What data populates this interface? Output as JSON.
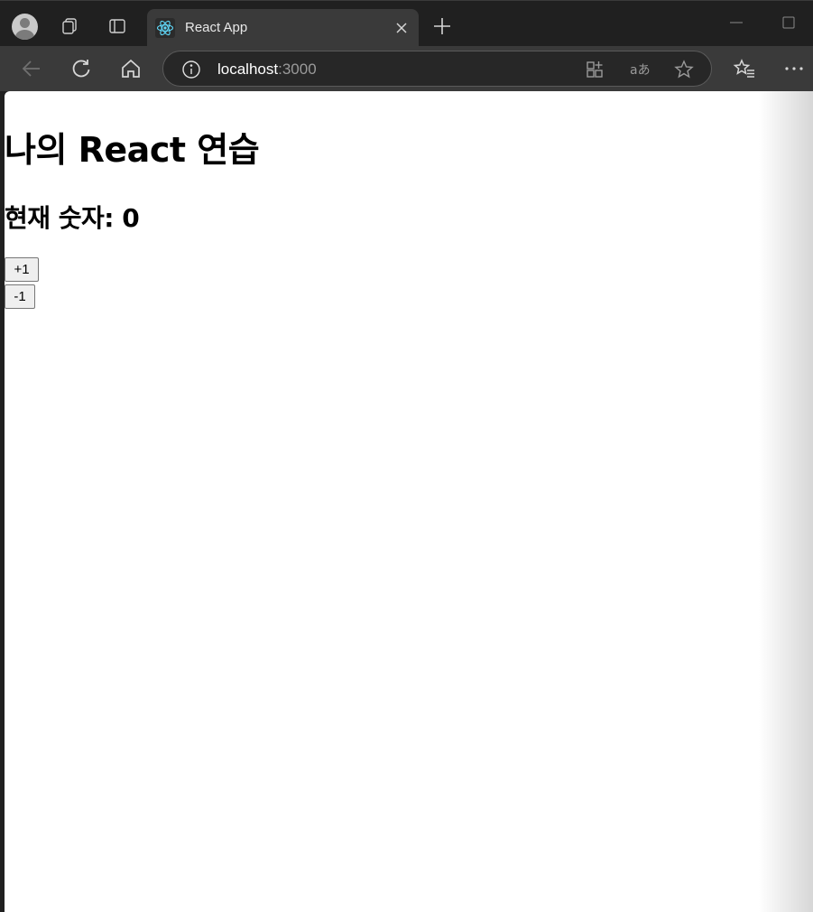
{
  "browser": {
    "tab": {
      "title": "React App"
    },
    "address": {
      "host": "localhost",
      "port": ":3000"
    }
  },
  "page": {
    "heading": "나의 React 연습",
    "counter_label": "현재 숫자: 0",
    "buttons": {
      "increment": "+1",
      "decrement": "-1"
    }
  },
  "colors": {
    "tab_strip": "#202020",
    "toolbar": "#3a3a3a",
    "react_logo": "#61dafb"
  }
}
